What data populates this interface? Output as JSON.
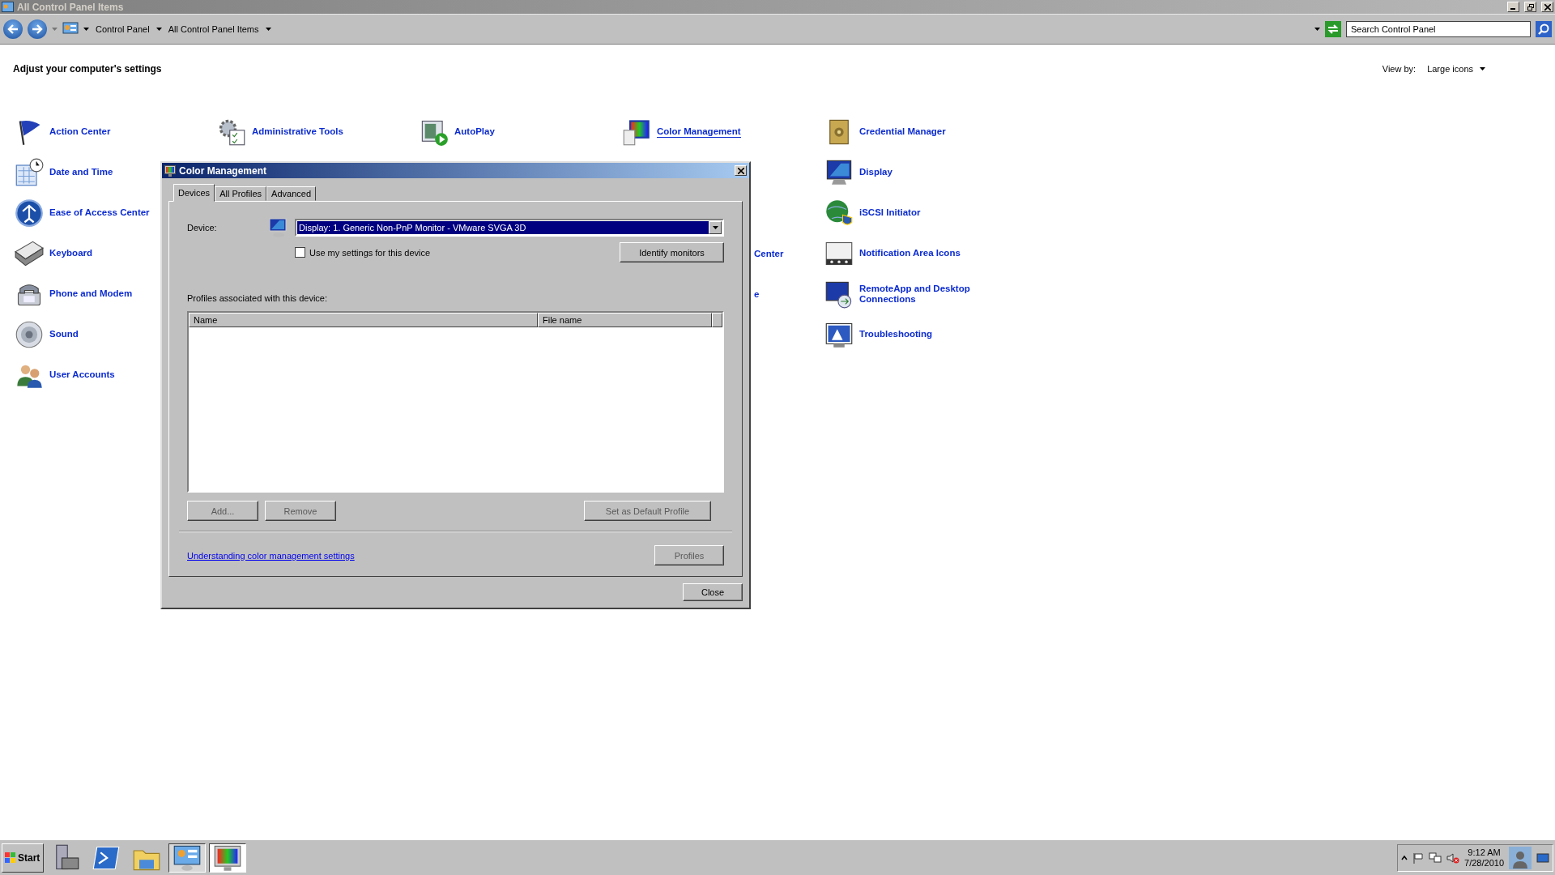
{
  "window": {
    "title": "All Control Panel Items"
  },
  "address_bar": {
    "breadcrumbs": [
      "Control Panel",
      "All Control Panel Items"
    ],
    "search": {
      "placeholder": "Search Control Panel"
    }
  },
  "header": {
    "title": "Adjust your computer's settings",
    "view_by_label": "View by:",
    "view_by_value": "Large icons"
  },
  "columns": [
    [
      {
        "label": "Action Center",
        "kind": "item",
        "hovered": false
      },
      {
        "label": "Date and Time",
        "kind": "item",
        "hovered": false
      },
      {
        "label": "Ease of Access Center",
        "kind": "item",
        "hovered": false
      },
      {
        "label": "Keyboard",
        "kind": "item",
        "hovered": false
      },
      {
        "label": "Phone and Modem",
        "kind": "item",
        "hovered": false
      },
      {
        "label": "Sound",
        "kind": "item",
        "hovered": false
      },
      {
        "label": "User Accounts",
        "kind": "item",
        "hovered": false
      }
    ],
    [
      {
        "label": "Administrative Tools",
        "kind": "item",
        "hovered": false
      }
    ],
    [
      {
        "label": "AutoPlay",
        "kind": "item",
        "hovered": false
      }
    ],
    [
      {
        "label": "Color Management",
        "kind": "item",
        "hovered": true
      },
      {
        "label": "Center",
        "kind": "fragment",
        "hovered": false
      },
      {
        "label": "e",
        "kind": "fragment",
        "hovered": false
      }
    ],
    [
      {
        "label": "Credential Manager",
        "kind": "item",
        "hovered": false
      },
      {
        "label": "Display",
        "kind": "item",
        "hovered": false
      },
      {
        "label": "iSCSI Initiator",
        "kind": "item",
        "hovered": false
      },
      {
        "label": "Notification Area Icons",
        "kind": "item",
        "hovered": false
      },
      {
        "label": "RemoteApp and Desktop Connections",
        "kind": "item",
        "hovered": false
      },
      {
        "label": "Troubleshooting",
        "kind": "item",
        "hovered": false
      }
    ]
  ],
  "dialog": {
    "title": "Color Management",
    "tabs": [
      {
        "label": "Devices",
        "selected": true
      },
      {
        "label": "All Profiles",
        "selected": false
      },
      {
        "label": "Advanced",
        "selected": false
      }
    ],
    "device_label": "Device:",
    "device_value": "Display: 1. Generic Non-PnP Monitor - VMware SVGA 3D",
    "use_my_settings": {
      "label": "Use my settings for this device",
      "checked": false
    },
    "identify_button": "Identify monitors",
    "profiles_label": "Profiles associated with this device:",
    "profile_columns": [
      "Name",
      "File name"
    ],
    "buttons": [
      {
        "label": "Add...",
        "disabled": true
      },
      {
        "label": "Remove",
        "disabled": true
      },
      {
        "label": "Set as Default Profile",
        "disabled": true
      }
    ],
    "link": "Understanding color management settings",
    "profiles_button": {
      "label": "Profiles",
      "disabled": true
    },
    "close_button": "Close"
  },
  "taskbar": {
    "start": "Start",
    "items": [
      {
        "open": false,
        "selected": false
      },
      {
        "open": false,
        "selected": false
      },
      {
        "open": false,
        "selected": false
      },
      {
        "open": true,
        "selected": false
      },
      {
        "open": true,
        "selected": true
      }
    ],
    "time": "9:12 AM",
    "date": "7/28/2010"
  }
}
